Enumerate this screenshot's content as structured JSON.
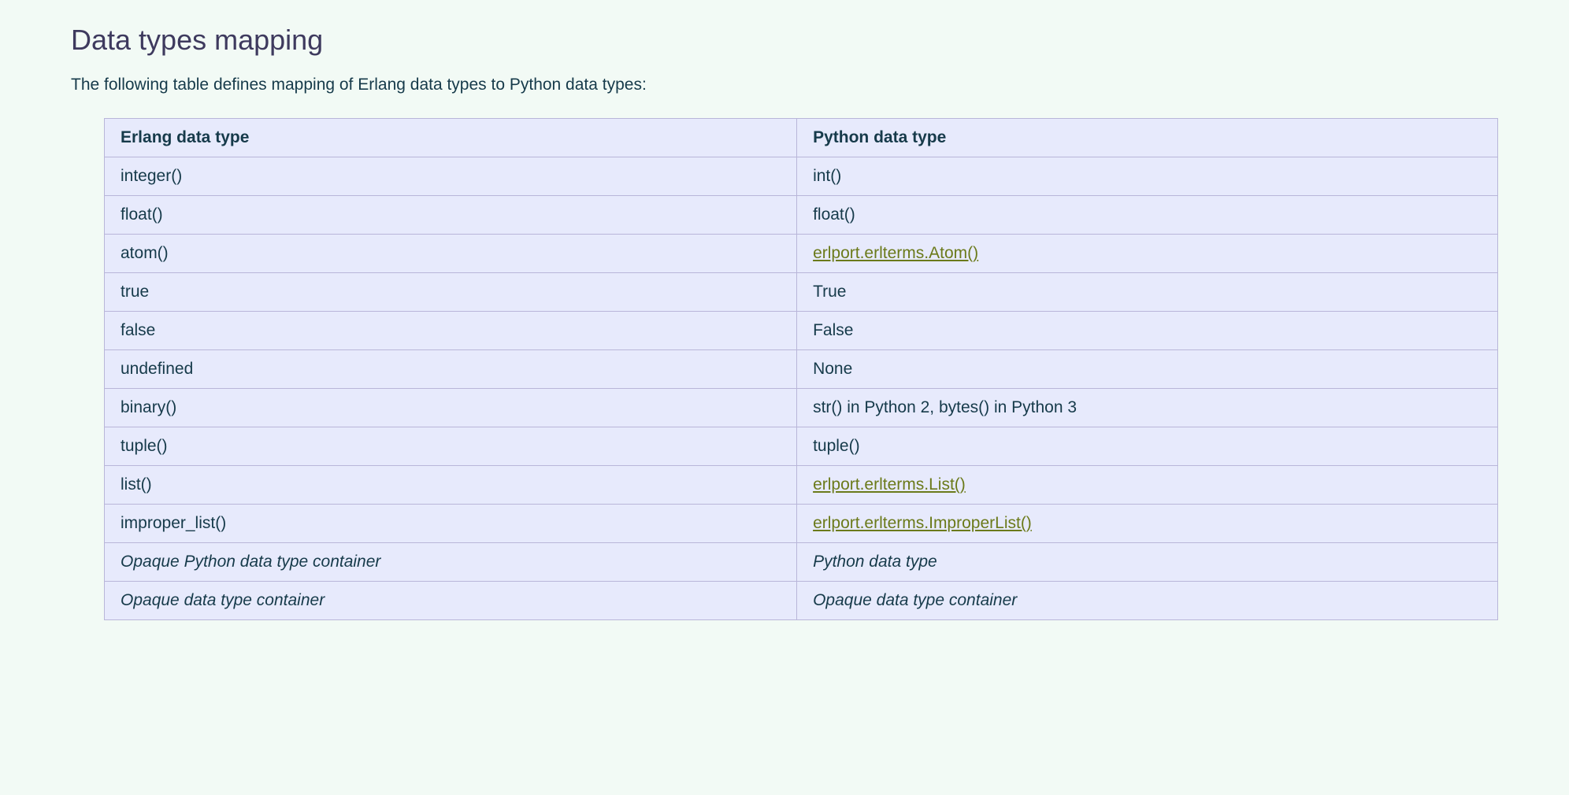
{
  "heading": "Data types mapping",
  "intro": "The following table defines mapping of Erlang data types to Python data types:",
  "table": {
    "headers": {
      "erlang": "Erlang data type",
      "python": "Python data type"
    },
    "rows": [
      {
        "erlang": "integer()",
        "python": "int()",
        "erlang_italic": false,
        "python_italic": false,
        "python_link": false
      },
      {
        "erlang": "float()",
        "python": "float()",
        "erlang_italic": false,
        "python_italic": false,
        "python_link": false
      },
      {
        "erlang": "atom()",
        "python": "erlport.erlterms.Atom()",
        "erlang_italic": false,
        "python_italic": false,
        "python_link": true
      },
      {
        "erlang": "true",
        "python": "True",
        "erlang_italic": false,
        "python_italic": false,
        "python_link": false
      },
      {
        "erlang": "false",
        "python": "False",
        "erlang_italic": false,
        "python_italic": false,
        "python_link": false
      },
      {
        "erlang": "undefined",
        "python": "None",
        "erlang_italic": false,
        "python_italic": false,
        "python_link": false
      },
      {
        "erlang": "binary()",
        "python": "str() in Python 2, bytes() in Python 3",
        "erlang_italic": false,
        "python_italic": false,
        "python_link": false
      },
      {
        "erlang": "tuple()",
        "python": "tuple()",
        "erlang_italic": false,
        "python_italic": false,
        "python_link": false
      },
      {
        "erlang": "list()",
        "python": "erlport.erlterms.List()",
        "erlang_italic": false,
        "python_italic": false,
        "python_link": true
      },
      {
        "erlang": "improper_list()",
        "python": "erlport.erlterms.ImproperList()",
        "erlang_italic": false,
        "python_italic": false,
        "python_link": true
      },
      {
        "erlang": "Opaque Python data type container",
        "python": "Python data type",
        "erlang_italic": true,
        "python_italic": true,
        "python_link": false
      },
      {
        "erlang": "Opaque data type container",
        "python": "Opaque data type container",
        "erlang_italic": true,
        "python_italic": true,
        "python_link": false
      }
    ]
  }
}
